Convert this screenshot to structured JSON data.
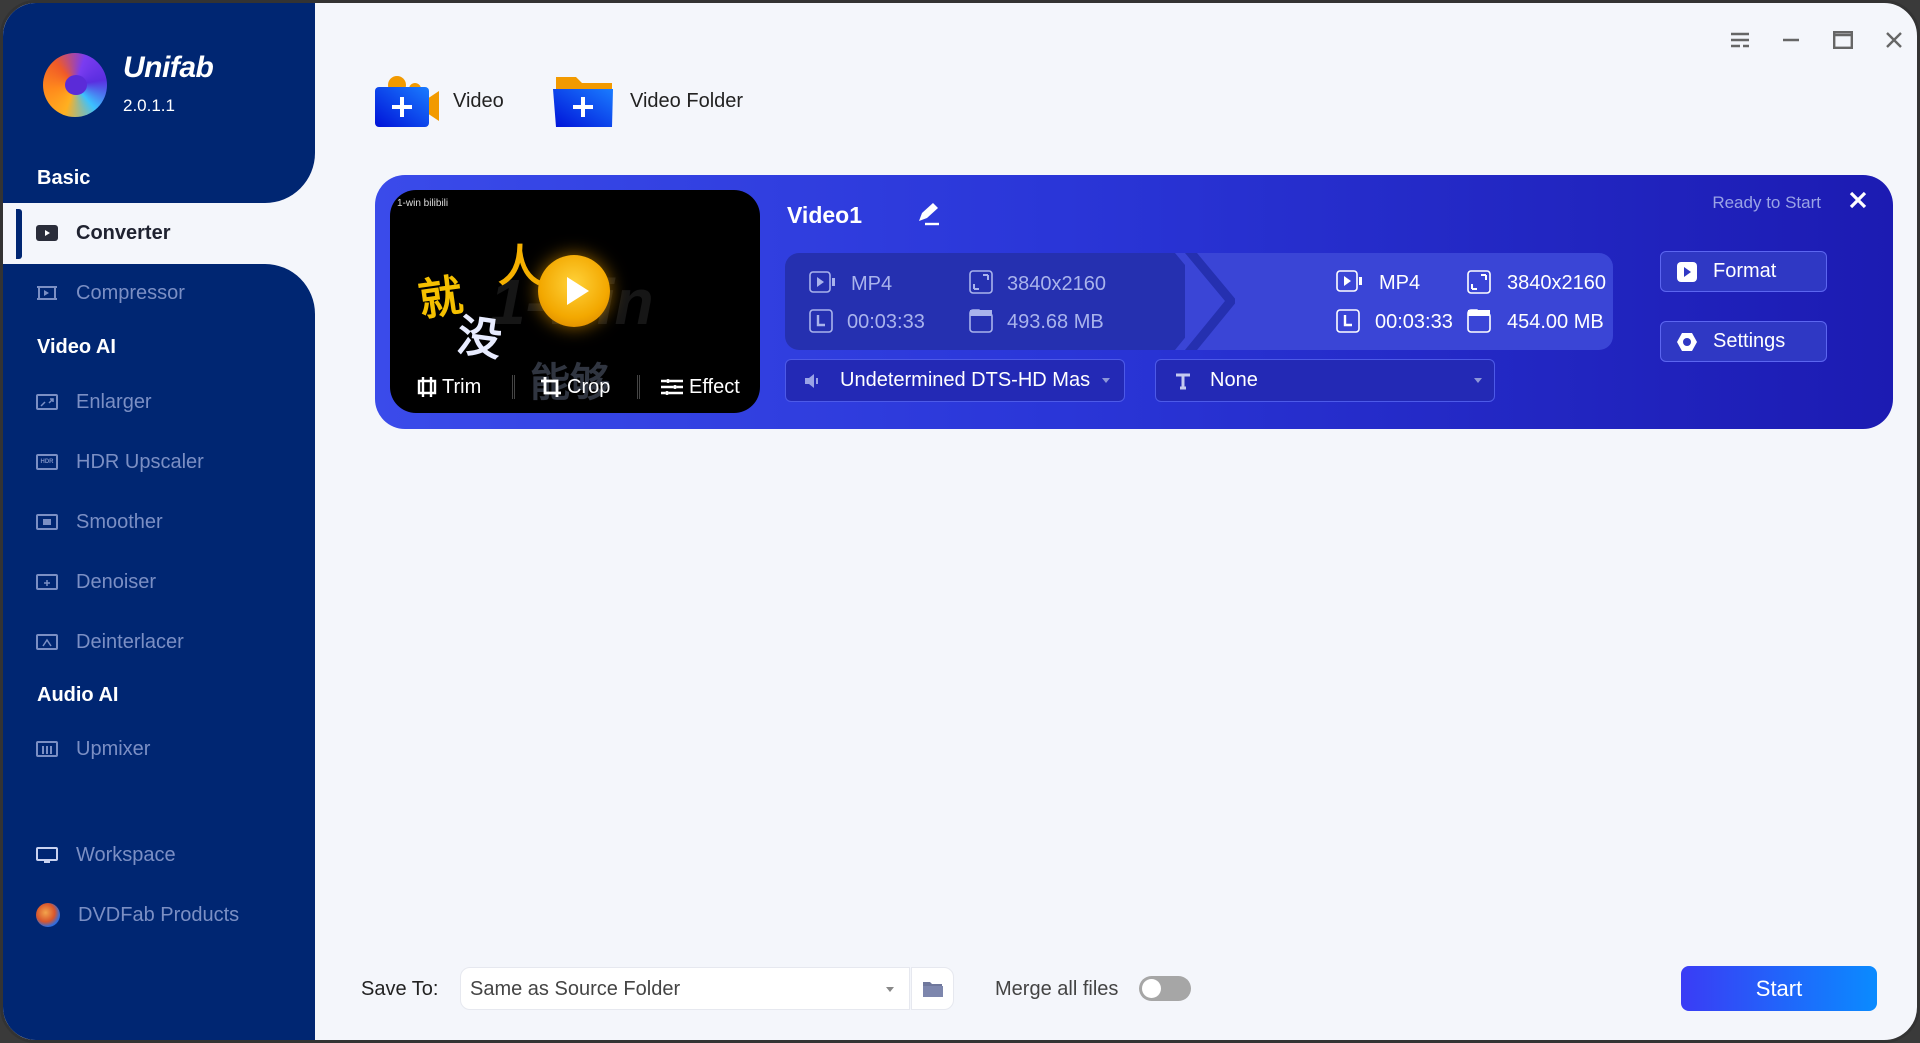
{
  "app": {
    "name": "Unifab",
    "version": "2.0.1.1"
  },
  "window_controls": [
    "menu-icon",
    "minimize-icon",
    "maximize-icon",
    "close-icon"
  ],
  "sidebar": {
    "sections": [
      {
        "title": "Basic",
        "items": [
          {
            "label": "Converter",
            "icon": "converter-icon",
            "active": true
          },
          {
            "label": "Compressor",
            "icon": "compressor-icon"
          }
        ]
      },
      {
        "title": "Video AI",
        "items": [
          {
            "label": "Enlarger",
            "icon": "enlarger-icon"
          },
          {
            "label": "HDR Upscaler",
            "icon": "hdr-icon"
          },
          {
            "label": "Smoother",
            "icon": "smoother-icon"
          },
          {
            "label": "Denoiser",
            "icon": "denoiser-icon"
          },
          {
            "label": "Deinterlacer",
            "icon": "deinterlacer-icon"
          }
        ]
      },
      {
        "title": "Audio AI",
        "items": [
          {
            "label": "Upmixer",
            "icon": "upmixer-icon"
          }
        ]
      }
    ],
    "footer": [
      {
        "label": "Workspace",
        "icon": "monitor-icon"
      },
      {
        "label": "DVDFab Products",
        "icon": "dvdfab-logo-icon"
      }
    ]
  },
  "toolbar": {
    "add_video": "Video",
    "add_folder": "Video Folder"
  },
  "task": {
    "title": "Video1",
    "status": "Ready to Start",
    "thumbnail": {
      "watermark": "1-win bilibili",
      "tools": [
        "Trim",
        "Crop",
        "Effect"
      ]
    },
    "source": {
      "format": "MP4",
      "resolution": "3840x2160",
      "duration": "00:03:33",
      "size": "493.68 MB"
    },
    "output": {
      "format": "MP4",
      "resolution": "3840x2160",
      "duration": "00:03:33",
      "size": "454.00 MB"
    },
    "audio_track": "Undetermined DTS-HD Mas",
    "subtitle": "None",
    "buttons": {
      "format": "Format",
      "settings": "Settings"
    }
  },
  "bottom": {
    "save_to_label": "Save To:",
    "save_to_value": "Same as Source Folder",
    "merge_label": "Merge all files",
    "merge_enabled": false,
    "start": "Start"
  },
  "colors": {
    "sidebar": "#002672",
    "accent": "#2a36d8",
    "start_from": "#3a3cf5",
    "start_to": "#0a8bff"
  }
}
